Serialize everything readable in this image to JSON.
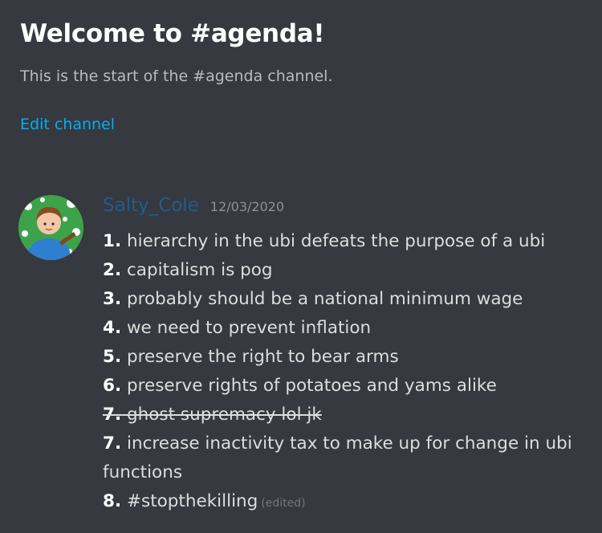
{
  "welcome": {
    "title": "Welcome to #agenda!",
    "subtitle": "This is the start of the #agenda channel.",
    "edit_label": "Edit channel"
  },
  "message": {
    "author": "Salty_Cole",
    "timestamp": "12/03/2020",
    "edited_label": "(edited)",
    "lines": [
      {
        "num": "1.",
        "text": " hierarchy in the ubi defeats the purpose of a ubi"
      },
      {
        "num": "2.",
        "text": " capitalism is pog"
      },
      {
        "num": "3.",
        "text": " probably should be a national minimum wage"
      },
      {
        "num": "4.",
        "text": " we need to prevent inflation"
      },
      {
        "num": "5.",
        "text": " preserve the right to bear arms"
      },
      {
        "num": "6.",
        "text": " preserve rights of potatoes and yams alike"
      },
      {
        "num": "7.",
        "text": " ghost supremacy lol jk"
      },
      {
        "num": "7.",
        "text": " increase inactivity tax to make up for change in ubi functions"
      },
      {
        "num": "8.",
        "text": " #stopthekilling"
      }
    ]
  },
  "colors": {
    "background": "#36393f",
    "link": "#00aff4",
    "username": "#1f5e8c",
    "text": "#dcddde"
  }
}
